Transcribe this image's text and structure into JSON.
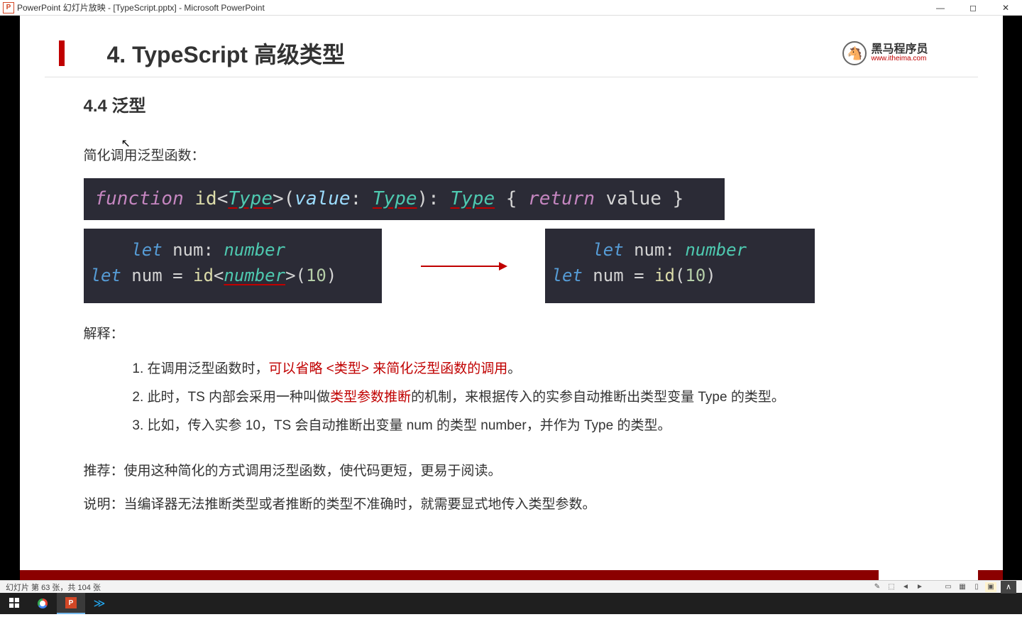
{
  "titlebar": {
    "app_icon_letter": "P",
    "title": "PowerPoint 幻灯片放映 - [TypeScript.pptx] - Microsoft PowerPoint"
  },
  "slide": {
    "title": "4. TypeScript 高级类型",
    "logo_cn": "黑马程序员",
    "logo_url": "www.itheima.com",
    "subheading": "4.4 泛型",
    "intro": "简化调用泛型函数：",
    "code1": {
      "func": "function ",
      "name": "id",
      "lt": "<",
      "type": "Type",
      "gt": ">",
      "lp": "(",
      "param": "value",
      "colon": ": ",
      "ptype": "Type",
      "rp": ")",
      "colon2": ": ",
      "rtype": "Type",
      "brace_l": " { ",
      "ret": "return ",
      "val": "value",
      "brace_r": " }"
    },
    "code_left": {
      "l1_let": "let ",
      "l1_var": "num",
      "l1_colon": ": ",
      "l1_type": "number",
      "l2_let": "let ",
      "l2_var": "num",
      "l2_eq": " = ",
      "l2_fn": "id",
      "l2_lt": "<",
      "l2_type": "number",
      "l2_gt": ">",
      "l2_lp": "(",
      "l2_arg": "10",
      "l2_rp": ")"
    },
    "code_right": {
      "l1_let": "let ",
      "l1_var": "num",
      "l1_colon": ": ",
      "l1_type": "number",
      "l2_let": "let ",
      "l2_var": "num",
      "l2_eq": " = ",
      "l2_fn": "id",
      "l2_lp": "(",
      "l2_arg": "10",
      "l2_rp": ")"
    },
    "explain_label": "解释：",
    "li1_a": "在调用泛型函数时，",
    "li1_b": "可以省略 <类型> 来简化泛型函数的调用",
    "li1_c": "。",
    "li2_a": "此时，TS 内部会采用一种叫做",
    "li2_b": "类型参数推断",
    "li2_c": "的机制，来根据传入的实参自动推断出类型变量 Type 的类型。",
    "li3": "比如，传入实参 10，TS 会自动推断出变量 num 的类型 number，并作为 Type 的类型。",
    "recommend": "推荐：使用这种简化的方式调用泛型函数，使代码更短，更易于阅读。",
    "note": "说明：当编译器无法推断类型或者推断的类型不准确时，就需要显式地传入类型参数。"
  },
  "statusbar": {
    "text": "幻灯片 第 63 张，共 104 张"
  }
}
